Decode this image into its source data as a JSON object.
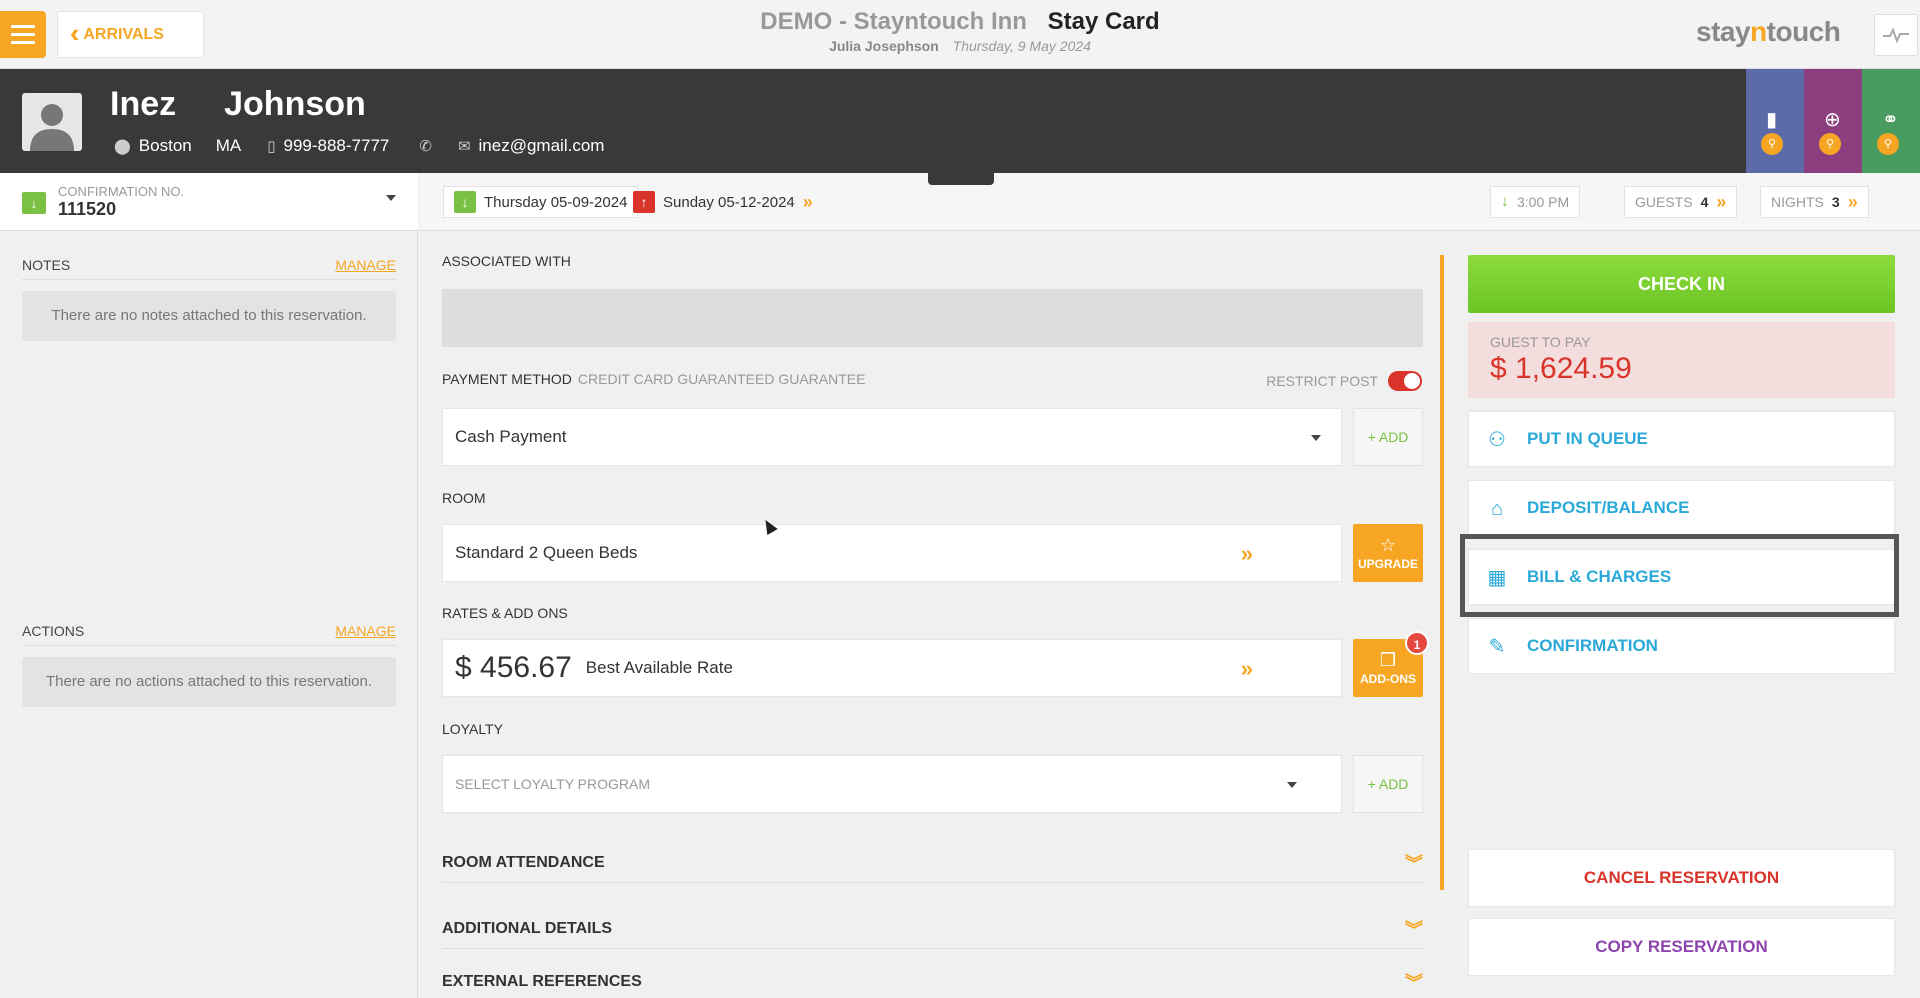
{
  "topbar": {
    "back_label": "ARRIVALS",
    "hotel_name": "DEMO - Stayntouch Inn",
    "page_title": "Stay Card",
    "user_name": "Julia Josephson",
    "business_date": "Thursday, 9 May 2024",
    "logo_prefix": "stay",
    "logo_n": "n",
    "logo_suffix": "touch"
  },
  "guest": {
    "first_name": "Inez",
    "last_name": "Johnson",
    "city": "Boston",
    "state": "MA",
    "phone": "999-888-7777",
    "email": "inez@gmail.com"
  },
  "reservation": {
    "confirmation_label": "CONFIRMATION NO.",
    "confirmation_number": "111520",
    "arrival_date": "Thursday 05-09-2024",
    "departure_date": "Sunday 05-12-2024",
    "arrival_time": "3:00 PM",
    "guests_label": "GUESTS",
    "guests_count": "4",
    "nights_label": "NIGHTS",
    "nights_count": "3"
  },
  "left": {
    "notes_title": "NOTES",
    "notes_manage": "MANAGE",
    "notes_empty": "There are no notes attached to this reservation.",
    "actions_title": "ACTIONS",
    "actions_manage": "MANAGE",
    "actions_empty": "There are no actions attached to this reservation."
  },
  "center": {
    "associated_label": "ASSOCIATED WITH",
    "payment_label": "PAYMENT METHOD",
    "payment_sub": "CREDIT CARD GUARANTEED GUARANTEE",
    "restrict_label": "RESTRICT POST",
    "payment_value": "Cash Payment",
    "add_label": "+ ADD",
    "room_label": "ROOM",
    "room_value": "Standard 2 Queen Beds",
    "upgrade_label": "UPGRADE",
    "rates_label": "RATES & ADD ONS",
    "rate_amount": "$ 456.67",
    "rate_name": "Best Available Rate",
    "addons_label": "ADD-ONS",
    "addons_badge": "1",
    "loyalty_label": "LOYALTY",
    "loyalty_placeholder": "SELECT LOYALTY PROGRAM",
    "sections": [
      "ROOM ATTENDANCE",
      "ADDITIONAL DETAILS",
      "EXTERNAL REFERENCES"
    ]
  },
  "right": {
    "checkin_label": "CHECK IN",
    "guest_to_pay_label": "GUEST TO PAY",
    "guest_to_pay_amount": "$ 1,624.59",
    "put_in_queue": "PUT IN QUEUE",
    "deposit_balance": "DEPOSIT/BALANCE",
    "bill_charges": "BILL & CHARGES",
    "confirmation": "CONFIRMATION",
    "cancel_reservation": "CANCEL RESERVATION",
    "copy_reservation": "COPY RESERVATION"
  },
  "colors": {
    "accent": "#f6a623",
    "header_bg": "#393939",
    "checkin_green": "#7ac143",
    "link_blue": "#2aa9d8",
    "danger_red": "#d9342b",
    "copy_purple": "#8e44ad"
  }
}
